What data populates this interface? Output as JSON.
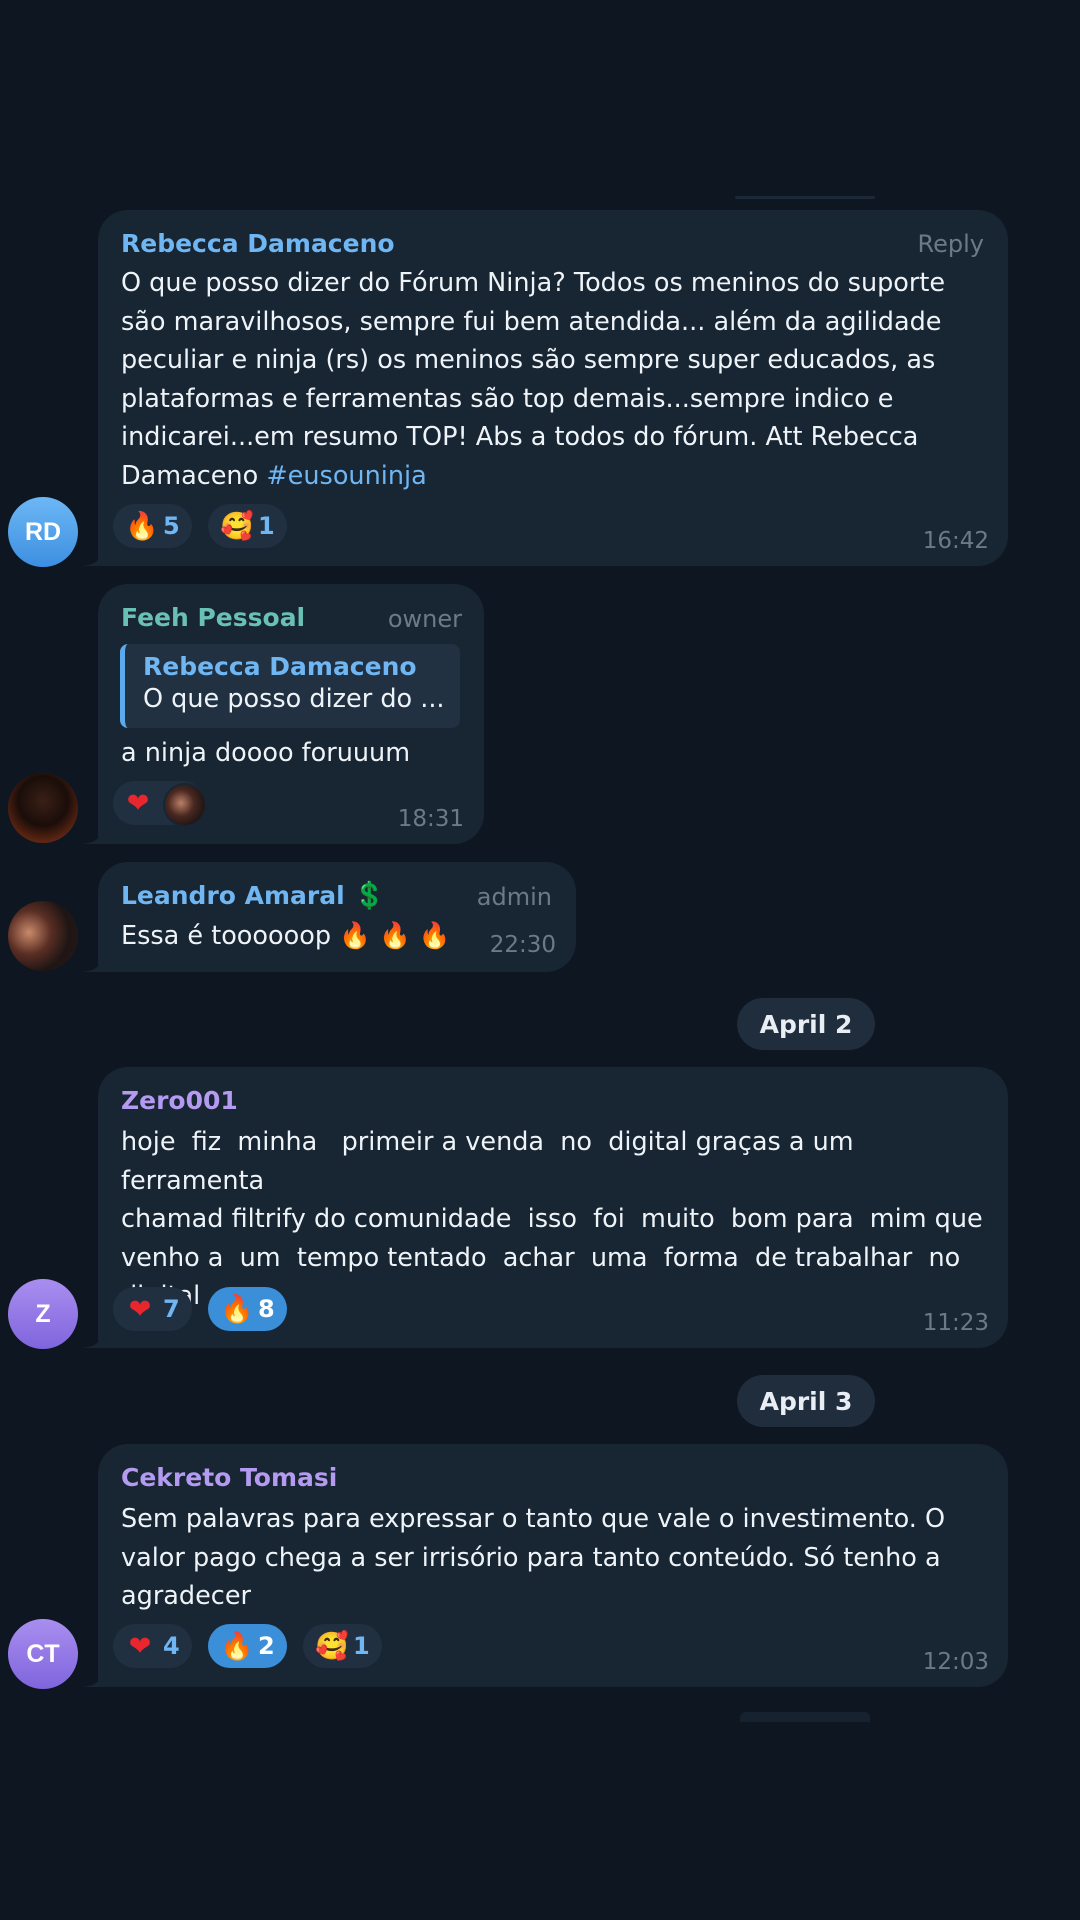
{
  "messages": [
    {
      "avatar_initials": "RD",
      "author": "Rebecca Damaceno",
      "action": "Reply",
      "text": "O que posso dizer do Fórum Ninja? Todos os meninos do suporte\nsão maravilhosos, sempre fui bem atendida... além da agilidade\npeculiar e ninja (rs) os meninos são sempre super educados, as\nplataformas e ferramentas são top demais...sempre indico e\nindicarei...em resumo TOP! Abs a todos do fórum. Att Rebecca\nDamaceno ",
      "hashtag": "#eusouninja",
      "reactions": [
        {
          "icon": "fire-icon",
          "emoji": "🔥",
          "count": "5"
        },
        {
          "icon": "smiling-hearts-icon",
          "emoji": "🥰",
          "count": "1"
        }
      ],
      "time": "16:42"
    },
    {
      "avatar_icon": "hooded-figure-avatar",
      "author": "Feeh Pessoal",
      "role": "owner",
      "reply_to": {
        "author": "Rebecca Damaceno",
        "snippet": "O que posso dizer do ..."
      },
      "text": "a ninja doooo foruuum",
      "reactions": [
        {
          "icon": "heart-icon",
          "emoji": "❤"
        }
      ],
      "time": "18:31"
    },
    {
      "avatar_icon": "group-photo-avatar",
      "author": "Leandro Amaral",
      "author_badge": "💲",
      "role": "admin",
      "text": "Essa é toooooop 🔥 🔥 🔥",
      "time": "22:30"
    },
    {
      "date_separator": "April 2",
      "avatar_initials": "Z",
      "author": "Zero001",
      "text": "hoje  fiz  minha   primeir a venda  no  digital graças a um  ferramenta\nchamad filtrify do comunidade  isso  foi  muito  bom para  mim que\nvenho a  um  tempo tentado  achar  uma  forma  de trabalhar  no\ndigital",
      "reactions": [
        {
          "icon": "heart-icon",
          "emoji": "❤",
          "count": "7"
        },
        {
          "icon": "fire-icon",
          "emoji": "🔥",
          "count": "8",
          "selected": true
        }
      ],
      "time": "11:23"
    },
    {
      "date_separator": "April 3",
      "avatar_initials": "CT",
      "author": "Cekreto Tomasi",
      "text": "Sem palavras para expressar o tanto que vale o investimento. O\nvalor pago chega a ser irrisório para tanto conteúdo. Só tenho a\nagradecer",
      "reactions": [
        {
          "icon": "heart-icon",
          "emoji": "❤",
          "count": "4"
        },
        {
          "icon": "fire-icon",
          "emoji": "🔥",
          "count": "2",
          "selected": true
        },
        {
          "icon": "smiling-hearts-icon",
          "emoji": "🥰",
          "count": "1"
        }
      ],
      "time": "12:03"
    }
  ],
  "colors": {
    "background": "#0e1621",
    "bubble": "#182533",
    "accent_blue": "#6fb6f2",
    "author_teal": "#69c1b6",
    "author_purple": "#b49af0",
    "muted": "#6c7a88",
    "reaction_selected": "#3b8fd8"
  }
}
